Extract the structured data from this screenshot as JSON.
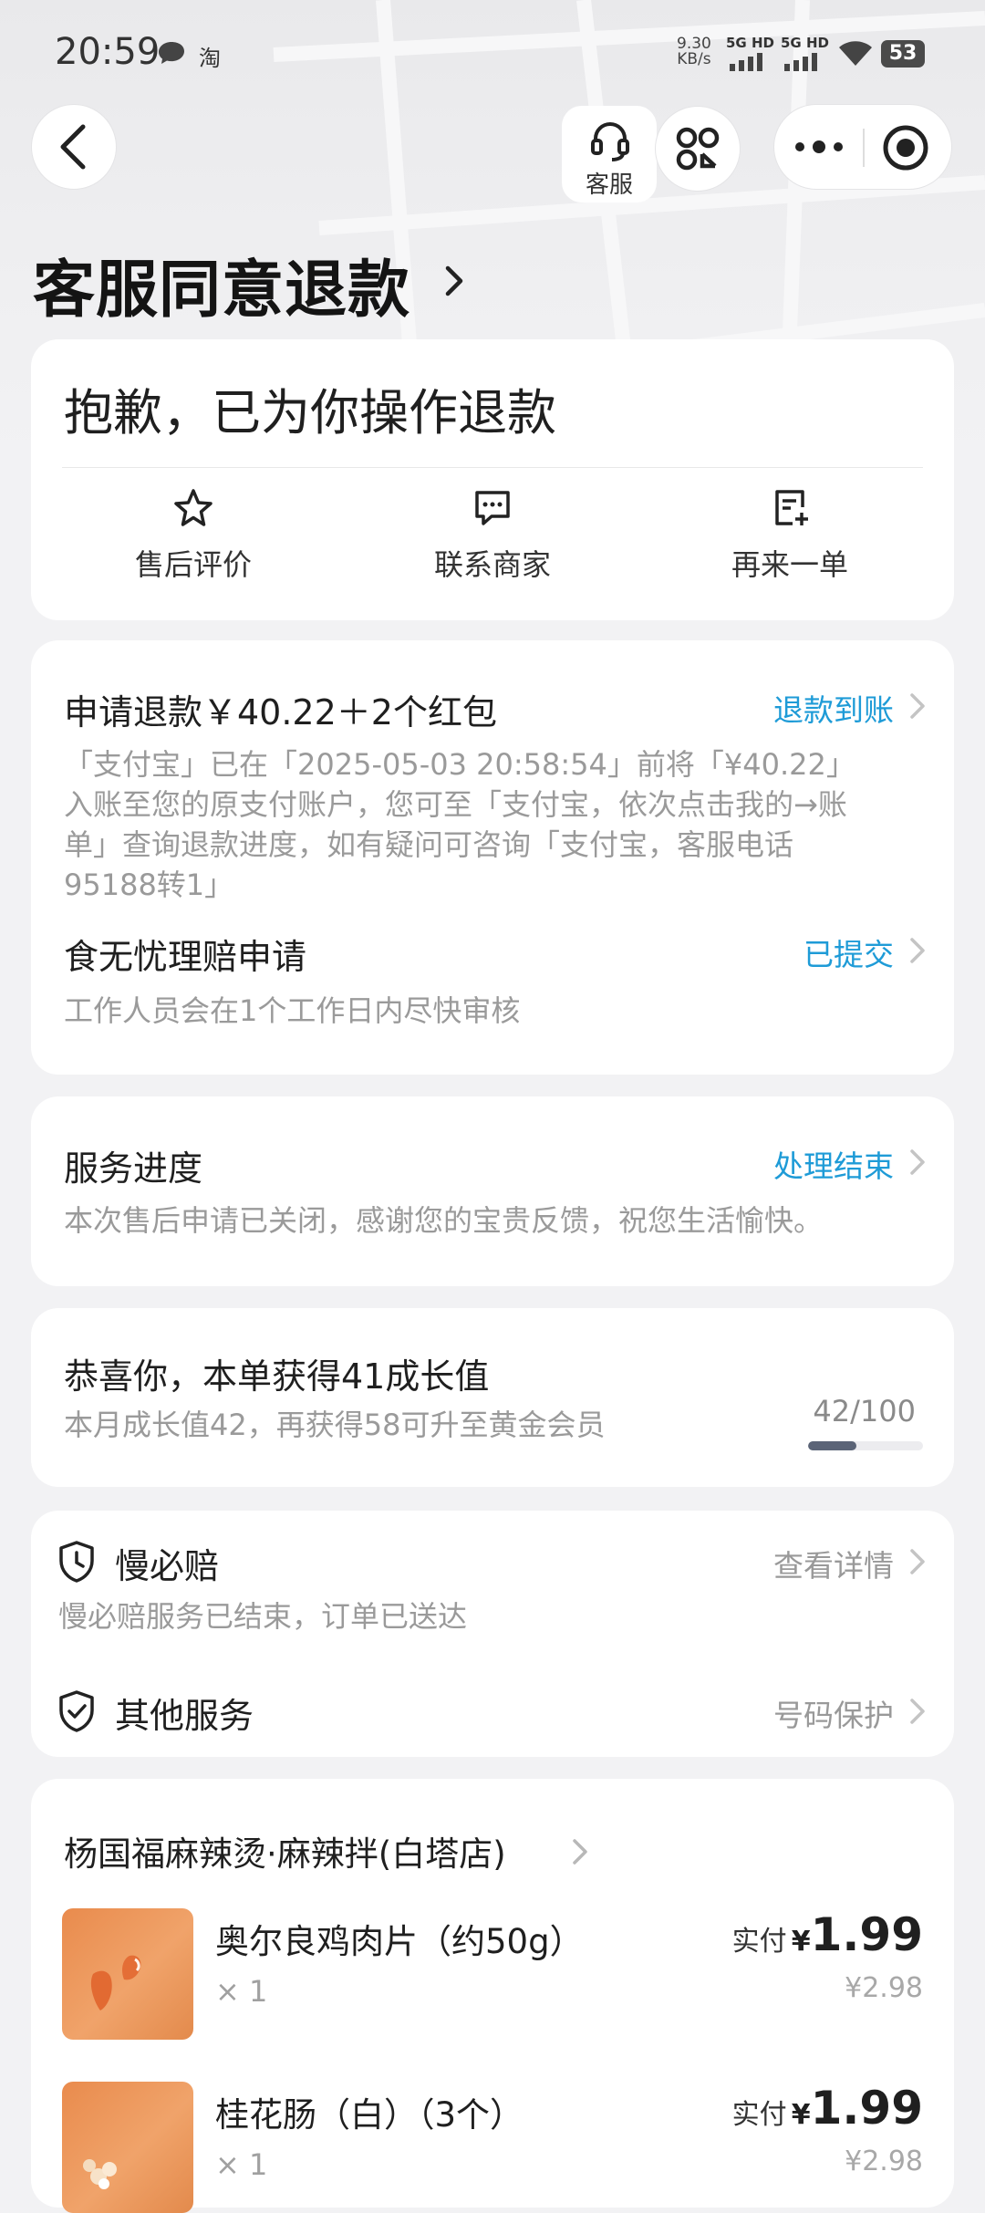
{
  "status_bar": {
    "time": "20:59",
    "app_badge": "淘",
    "net_speed_value": "9.30",
    "net_speed_unit": "KB/s",
    "signal_1": "5G HD",
    "signal_2": "5G HD",
    "battery": "53"
  },
  "nav": {
    "service_label": "客服"
  },
  "page": {
    "title": "客服同意退款"
  },
  "apology_card": {
    "message": "抱歉，已为你操作退款",
    "actions": [
      {
        "label": "售后评价",
        "icon": "star-icon"
      },
      {
        "label": "联系商家",
        "icon": "chat-icon"
      },
      {
        "label": "再来一单",
        "icon": "reorder-icon"
      }
    ]
  },
  "refund_card": {
    "title": "申请退款￥40.22＋2个红包",
    "status": "退款到账",
    "detail_lines": [
      "「支付宝」已在「2025-05-03 20:58:54」前将「¥40.22」",
      "入账至您的原支付账户，您可至「支付宝，依次点击我的→账",
      "单」查询退款进度，如有疑问可咨询「支付宝，客服电话",
      "95188转1」"
    ],
    "claim_title": "食无忧理赔申请",
    "claim_status": "已提交",
    "claim_desc": "工作人员会在1个工作日内尽快审核"
  },
  "progress_card": {
    "title": "服务进度",
    "status": "处理结束",
    "desc": "本次售后申请已关闭，感谢您的宝贵反馈，祝您生活愉快。"
  },
  "growth_card": {
    "title": "恭喜你，本单获得41成长值",
    "desc": "本月成长值42，再获得58可升至黄金会员",
    "progress_text": "42/100",
    "progress_fraction": 0.42
  },
  "services_card": {
    "slow_title": "慢必赔",
    "slow_link": "查看详情",
    "slow_desc": "慢必赔服务已结束，订单已送达",
    "other_title": "其他服务",
    "other_link": "号码保护"
  },
  "order_card": {
    "shop_name": "杨国福麻辣烫·麻辣拌(白塔店)",
    "items": [
      {
        "name": "奥尔良鸡肉片（约50g）",
        "qty": "× 1",
        "paid_label": "实付",
        "currency": "¥",
        "price": "1.99",
        "original": "¥2.98"
      },
      {
        "name": "桂花肠（白）（3个）",
        "qty": "× 1",
        "paid_label": "实付",
        "currency": "¥",
        "price": "1.99",
        "original": "¥2.98"
      }
    ]
  },
  "colors": {
    "accent_blue": "#1e9bd7",
    "page_bg": "#f2f2f4",
    "card_bg": "#ffffff",
    "muted_text": "#9a9a9a"
  }
}
